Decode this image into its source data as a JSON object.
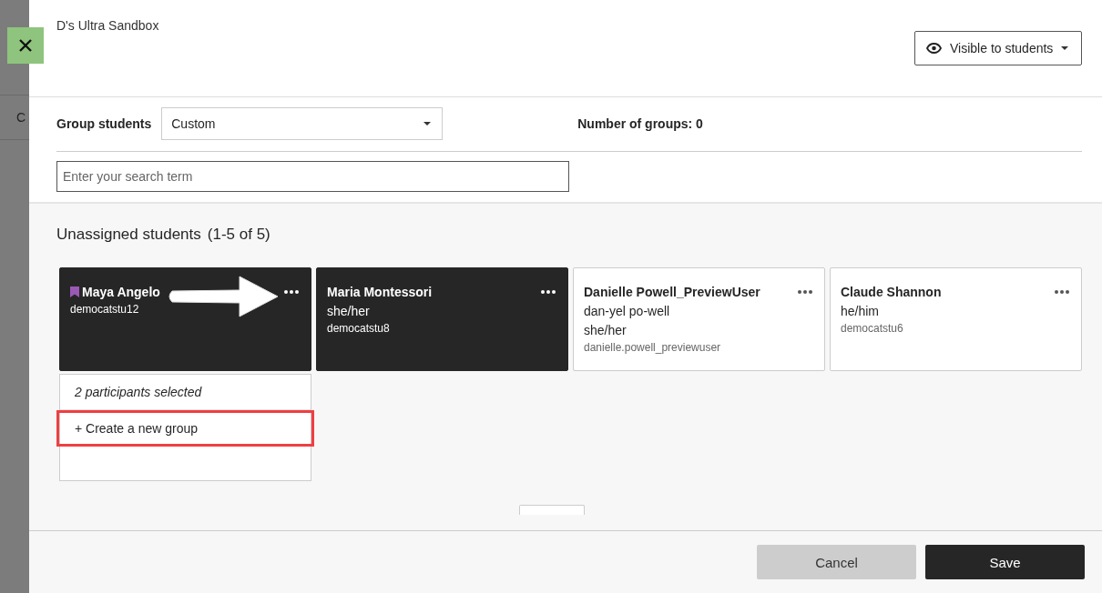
{
  "background": {
    "label": "C"
  },
  "course_title": "D's Ultra Sandbox",
  "visibility": {
    "label": "Visible to students"
  },
  "group_students": {
    "label": "Group students",
    "value": "Custom"
  },
  "number_of_groups": "Number of groups: 0",
  "search": {
    "placeholder": "Enter your search term"
  },
  "unassigned": {
    "title": "Unassigned students",
    "count": "(1-5 of 5)"
  },
  "students": [
    {
      "name": "Maya Angelo",
      "username": "democatstu12",
      "selected": true,
      "flagged": true
    },
    {
      "name": "Maria Montessori",
      "details": [
        "she/her"
      ],
      "username": "democatstu8",
      "selected": true,
      "flagged": false
    },
    {
      "name": "Danielle Powell_PreviewUser",
      "details": [
        "dan-yel po-well",
        "she/her"
      ],
      "username": "danielle.powell_previewuser",
      "selected": false,
      "flagged": false
    },
    {
      "name": "Claude Shannon",
      "details": [
        "he/him"
      ],
      "username": "democatstu6",
      "selected": false,
      "flagged": false
    }
  ],
  "selection_menu": {
    "caption": "2 participants selected",
    "items": [
      {
        "label": "+ Create a new group",
        "highlighted": true
      }
    ]
  },
  "annotation_arrow": true,
  "footer": {
    "buttons": [
      {
        "label": "Cancel",
        "kind": "secondary"
      },
      {
        "label": "Save",
        "kind": "primary"
      }
    ]
  }
}
